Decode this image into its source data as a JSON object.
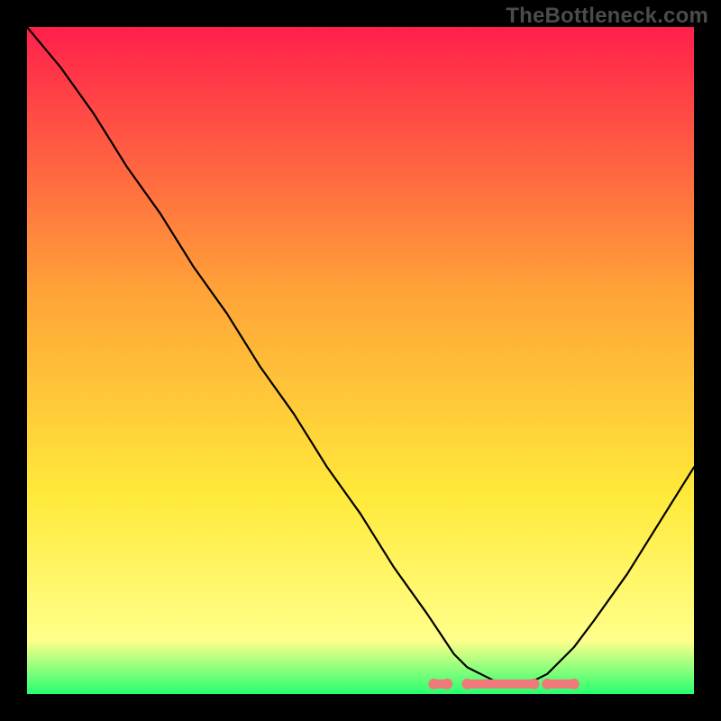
{
  "watermark": "TheBottleneck.com",
  "chart_data": {
    "type": "line",
    "title": "",
    "xlabel": "",
    "ylabel": "",
    "ylim": [
      0,
      100
    ],
    "xlim": [
      0,
      100
    ],
    "gradient_colors": {
      "top": "#ff1f4b",
      "mid_upper": "#ffa438",
      "mid": "#ffe93a",
      "mid_lower": "#ffff8a",
      "bottom": "#27ff70"
    },
    "series": [
      {
        "name": "bottleneck-curve",
        "x": [
          0,
          5,
          10,
          15,
          20,
          25,
          30,
          35,
          40,
          45,
          50,
          55,
          60,
          62,
          64,
          66,
          68,
          70,
          72,
          74,
          76,
          78,
          80,
          82,
          85,
          90,
          95,
          100
        ],
        "y": [
          100,
          94,
          87,
          79,
          72,
          64,
          57,
          49,
          42,
          34,
          27,
          19,
          12,
          9,
          6,
          4,
          3,
          2,
          1.5,
          1.5,
          2,
          3,
          5,
          7,
          11,
          18,
          26,
          34
        ]
      }
    ],
    "annotations": {
      "bottom_markers": {
        "color": "#f07a7a",
        "segments": [
          {
            "x0": 61,
            "x1": 63
          },
          {
            "x0": 66,
            "x1": 76
          },
          {
            "x0": 78,
            "x1": 82
          }
        ],
        "y": 1.5
      }
    }
  }
}
